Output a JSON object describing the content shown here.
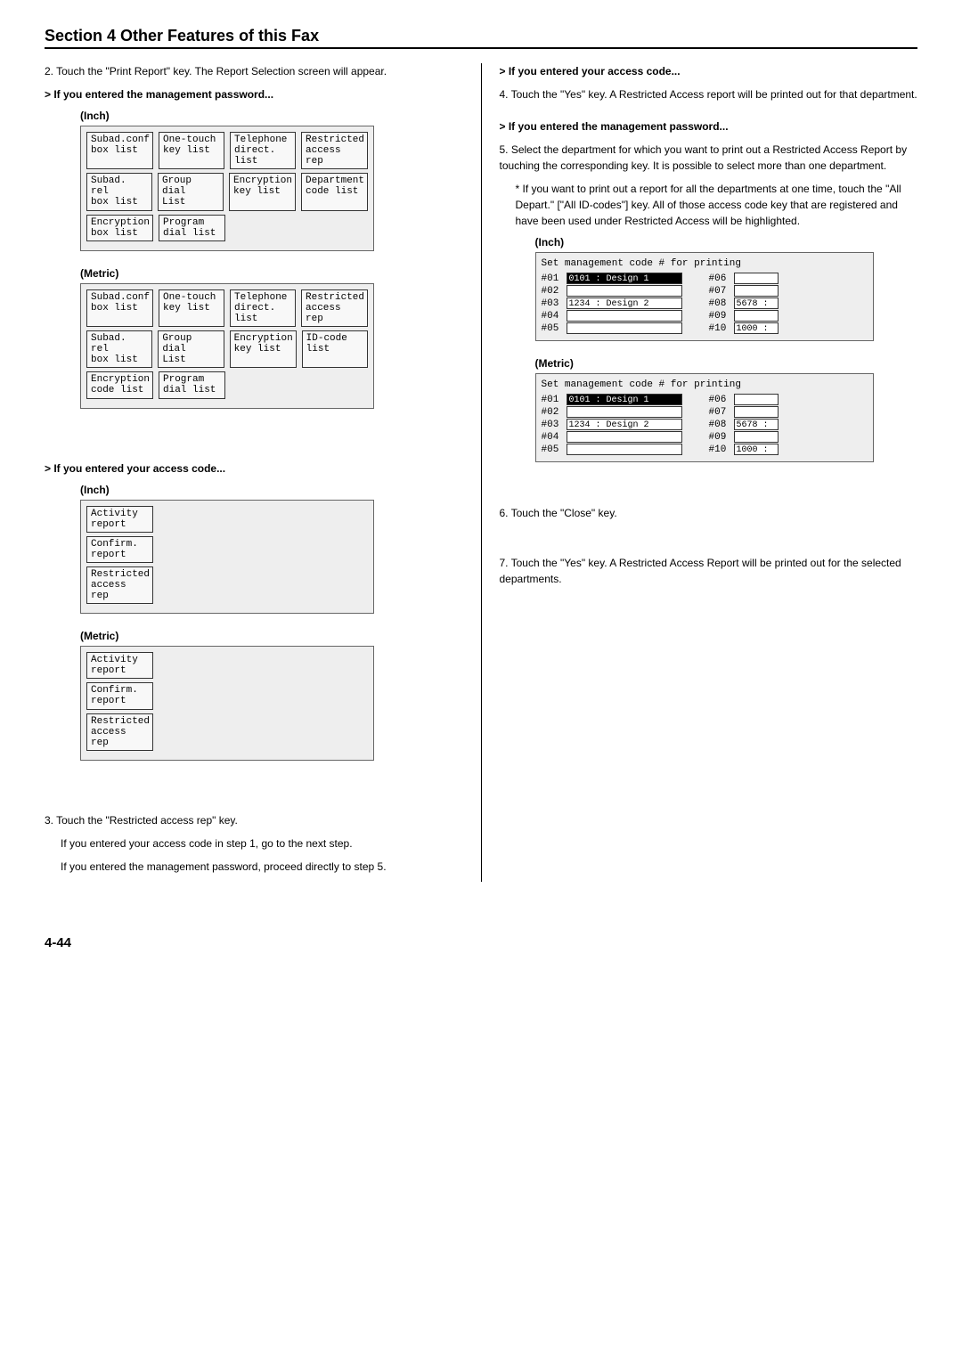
{
  "header": {
    "title": "Section 4 Other Features of this Fax"
  },
  "left": {
    "step2": "2. Touch the \"Print Report\" key. The Report Selection screen will appear.",
    "mgmt_heading": "> If you entered the management password...",
    "inch_label": "(Inch)",
    "metric_label": "(Metric)",
    "panel_inch": {
      "r1c1": "Subad.conf\nbox list",
      "r1c2": "One-touch\nkey list",
      "r1c3": "Telephone\ndirect. list",
      "r1c4": "Restricted\naccess rep",
      "r2c1": "Subad. rel\nbox list",
      "r2c2": "Group dial\nList",
      "r2c3": "Encryption\nkey list",
      "r2c4": "Department\ncode list",
      "r3c1": "Encryption\nbox list",
      "r3c2": "Program\ndial list"
    },
    "panel_metric": {
      "r1c1": "Subad.conf\nbox list",
      "r1c2": "One-touch\nkey list",
      "r1c3": "Telephone\ndirect. list",
      "r1c4": "Restricted\naccess rep",
      "r2c1": "Subad. rel\nbox list",
      "r2c2": "Group dial\nList",
      "r2c3": "Encryption\nkey list",
      "r2c4": "ID-code\nlist",
      "r3c1": "Encryption\ncode list",
      "r3c2": "Program\ndial list"
    },
    "access_heading": "> If you entered your access code...",
    "panel2_inch": {
      "b1": "Activity\nreport",
      "b2": "Confirm.\nreport",
      "b3": "Restricted\naccess rep"
    },
    "panel2_metric": {
      "b1": "Activity\nreport",
      "b2": "Confirm.\nreport",
      "b3": "Restricted\naccess rep"
    },
    "step3_line1": "3. Touch the \"Restricted access rep\" key.",
    "step3_line2": "If you entered your access code in step 1, go to the next step.",
    "step3_line3": "If you entered the management password, proceed directly to step 5."
  },
  "right": {
    "access_heading": "> If you entered your access code...",
    "step4": "4. Touch the \"Yes\" key. A Restricted Access report will be printed out for that department.",
    "mgmt_heading": "> If you entered the management password...",
    "step5_line1": "5. Select the department for which you want to print out a Restricted Access Report by touching the corresponding key. It is possible to select more than one department.",
    "step5_note": "* If you want to print out a report for all the departments at one time, touch the \"All Depart.\" [\"All ID-codes\"] key. All of those access code key that are registered and have been used under Restricted Access will be highlighted.",
    "inch_label": "(Inch)",
    "metric_label": "(Metric)",
    "panel3_hdr": "Set management code # for printing",
    "rows": {
      "r01": "#01",
      "r02": "#02",
      "r03": "#03",
      "r04": "#04",
      "r05": "#05",
      "r06": "#06",
      "r07": "#07",
      "r08": "#08",
      "r09": "#09",
      "r10": "#10",
      "v01": "0101 : Design 1",
      "v03": "1234 : Design 2",
      "v08": "5678 :",
      "v10": "1000 :"
    },
    "step6": "6. Touch the \"Close\" key.",
    "step7": "7. Touch the \"Yes\" key. A Restricted Access Report will be printed out for the selected departments."
  },
  "footer": {
    "page": "4-44"
  }
}
